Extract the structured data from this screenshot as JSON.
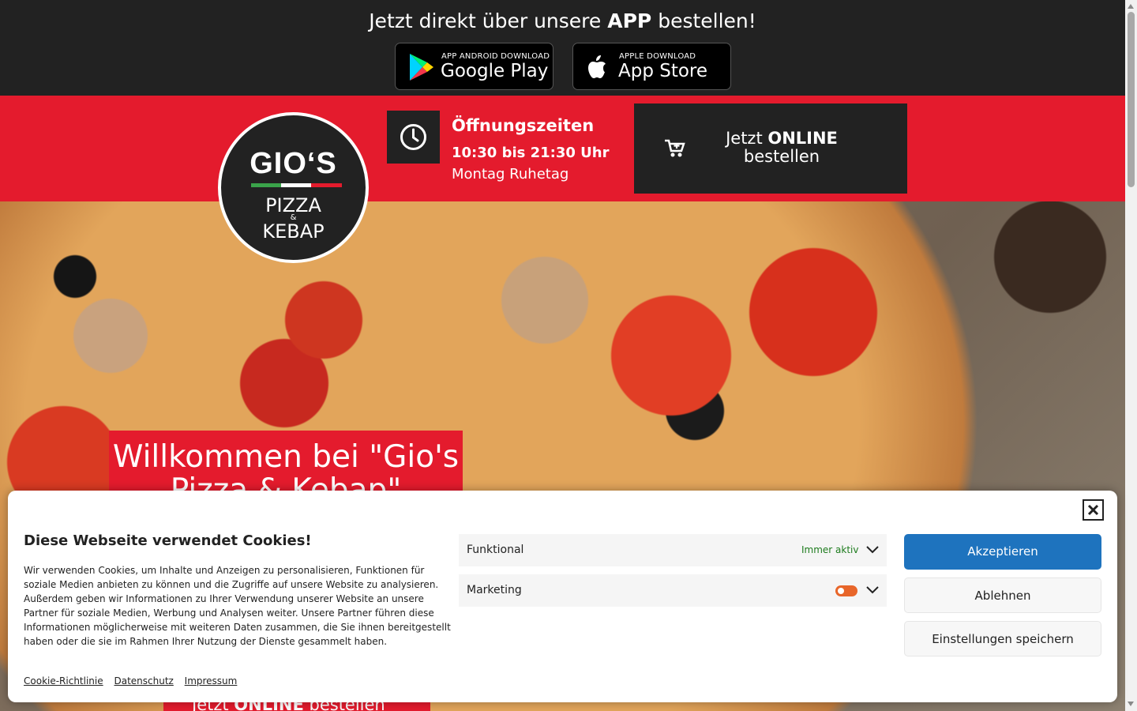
{
  "appbar": {
    "title_prefix": "Jetzt direkt über unsere ",
    "title_bold": "APP",
    "title_suffix": " bestellen!",
    "google_play": {
      "small": "APP ANDROID DOWNLOAD",
      "big": "Google Play"
    },
    "app_store": {
      "small": "APPLE DOWNLOAD",
      "big": "App Store"
    }
  },
  "logo": {
    "brand": "GIO‘S",
    "line1": "PIZZA",
    "amp": "&",
    "line2": "KEBAP"
  },
  "hours": {
    "title": "Öffnungszeiten",
    "time": "10:30 bis 21:30 Uhr",
    "note": "Montag Ruhetag"
  },
  "order_button": {
    "prefix": "Jetzt ",
    "bold": "ONLINE",
    "suffix": "bestellen"
  },
  "hero": {
    "welcome": "Willkommen bei \"Gio's Pizza & Kebap\"",
    "order_prefix": "Jetzt ",
    "order_bold": "ONLINE",
    "order_suffix": " bestellen"
  },
  "cookie": {
    "title": "Diese Webseite verwendet Cookies!",
    "text": "Wir verwenden Cookies, um Inhalte und Anzeigen zu personalisieren, Funktionen für soziale Medien anbieten zu können und die Zugriffe auf unsere Website zu analysieren. Außerdem geben wir Informationen zu Ihrer Verwendung unserer Website an unsere Partner für soziale Medien, Werbung und Analysen weiter. Unsere Partner führen diese Informationen möglicherweise mit weiteren Daten zusammen, die Sie ihnen bereitgestellt haben oder die sie im Rahmen Ihrer Nutzung der Dienste gesammelt haben.",
    "links": [
      "Cookie-Richtlinie",
      "Datenschutz",
      "Impressum"
    ],
    "categories": [
      {
        "label": "Funktional",
        "status": "Immer aktiv"
      },
      {
        "label": "Marketing",
        "enabled": false
      }
    ],
    "buttons": {
      "accept": "Akzeptieren",
      "deny": "Ablehnen",
      "save": "Einstellungen speichern"
    }
  },
  "colors": {
    "red": "#e41b2d",
    "dark": "#222222",
    "accept_blue": "#1e73be",
    "toggle_orange": "#e8662a",
    "active_green": "#1e7c1e"
  }
}
